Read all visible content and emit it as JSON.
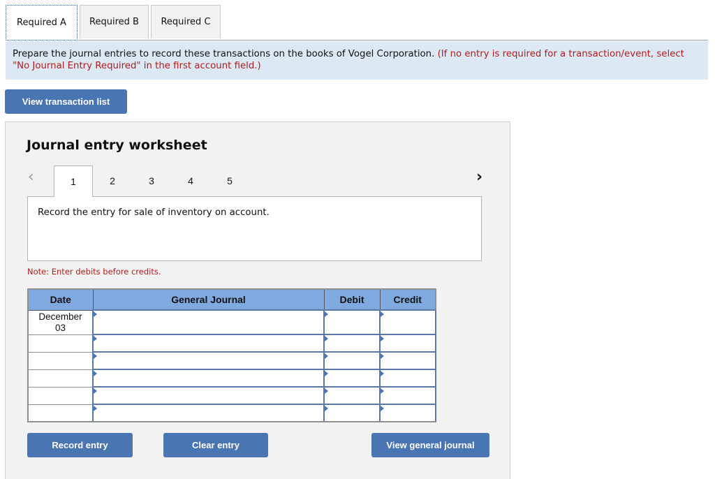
{
  "tabs": [
    {
      "label": "Required A",
      "active": true
    },
    {
      "label": "Required B",
      "active": false
    },
    {
      "label": "Required C",
      "active": false
    }
  ],
  "instructions": {
    "main": "Prepare the journal entries to record these transactions on the books of Vogel Corporation. ",
    "highlight": "(If no entry is required for a transaction/event, select \"No Journal Entry Required\" in the first account field.)"
  },
  "view_transaction_list_label": "View transaction list",
  "worksheet": {
    "title": "Journal entry worksheet",
    "prev_icon": "chevron-left-icon",
    "next_icon": "chevron-right-icon",
    "steps": [
      "1",
      "2",
      "3",
      "4",
      "5"
    ],
    "active_step": "1",
    "description": "Record the entry for sale of inventory on account.",
    "note": "Note: Enter debits before credits.",
    "table": {
      "headers": {
        "date": "Date",
        "account": "General Journal",
        "debit": "Debit",
        "credit": "Credit"
      },
      "rows": [
        {
          "date_line1": "December",
          "date_line2": "03",
          "account": "",
          "debit": "",
          "credit": ""
        },
        {
          "date_line1": "",
          "date_line2": "",
          "account": "",
          "debit": "",
          "credit": ""
        },
        {
          "date_line1": "",
          "date_line2": "",
          "account": "",
          "debit": "",
          "credit": ""
        },
        {
          "date_line1": "",
          "date_line2": "",
          "account": "",
          "debit": "",
          "credit": ""
        },
        {
          "date_line1": "",
          "date_line2": "",
          "account": "",
          "debit": "",
          "credit": ""
        },
        {
          "date_line1": "",
          "date_line2": "",
          "account": "",
          "debit": "",
          "credit": ""
        }
      ]
    },
    "buttons": {
      "record": "Record entry",
      "clear": "Clear entry",
      "view_general_journal": "View general journal"
    }
  }
}
